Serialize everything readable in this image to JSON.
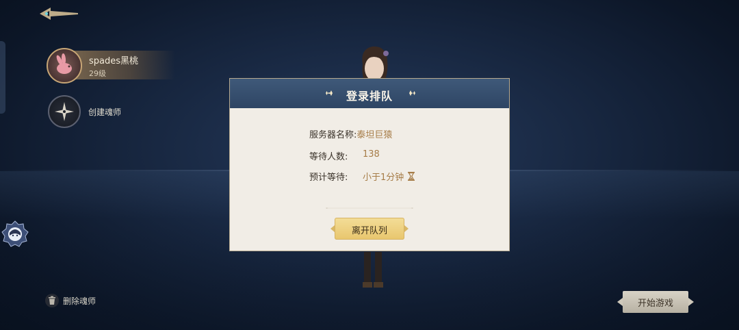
{
  "account": {
    "name": "spades黑桃",
    "level": "29级"
  },
  "sidebar": {
    "create_label": "创建魂师",
    "delete_label": "删除魂师"
  },
  "dialog": {
    "title": "登录排队",
    "server_label": "服务器名称:",
    "server_value": "泰坦巨猿",
    "waiting_label": "等待人数:",
    "waiting_value": "138",
    "eta_label": "预计等待:",
    "eta_value": "小于1分钟",
    "eta_icon": "hourglass-icon",
    "leave_label": "离开队列"
  },
  "footer": {
    "start_label": "开始游戏"
  },
  "colors": {
    "accent_gold": "#a67c47",
    "header_blue": "#3f5979",
    "button_gold": "#e8c66d"
  }
}
